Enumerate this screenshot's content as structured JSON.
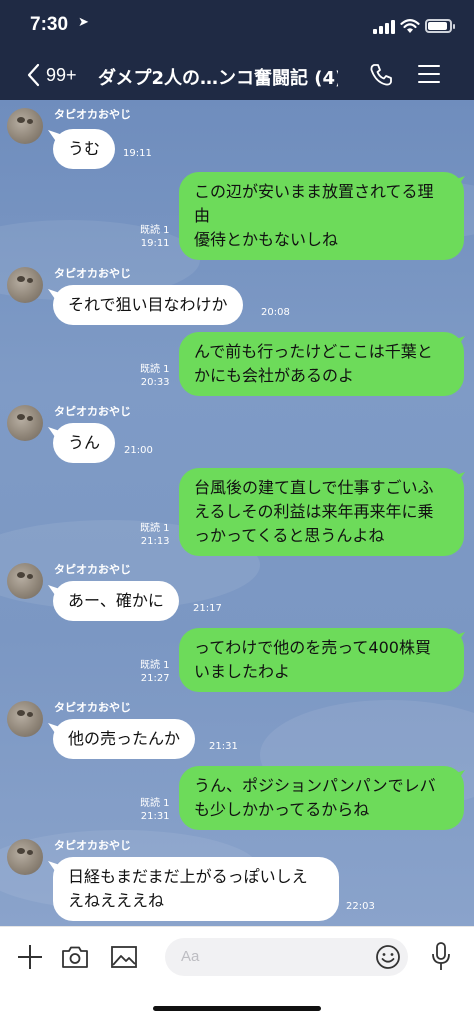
{
  "status_bar": {
    "time": "7:30"
  },
  "header": {
    "back_count": "99+",
    "title": "ダメプ2人の…ンコ奮闘記 (4)"
  },
  "messages": [
    {
      "dir": "in",
      "sender": "タピオカおやじ",
      "lines": [
        "うむ"
      ],
      "time": "19:11"
    },
    {
      "dir": "out",
      "read": "既読 1",
      "lines": [
        "この辺が安いまま放置されてる理",
        "由",
        "優待とかもないしね"
      ],
      "time": "19:11"
    },
    {
      "dir": "in",
      "sender": "タピオカおやじ",
      "lines": [
        "それで狙い目なわけか"
      ],
      "time": "20:08"
    },
    {
      "dir": "out",
      "read": "既読 1",
      "lines": [
        "んで前も行ったけどここは千葉と",
        "かにも会社があるのよ"
      ],
      "time": "20:33"
    },
    {
      "dir": "in",
      "sender": "タピオカおやじ",
      "lines": [
        "うん"
      ],
      "time": "21:00"
    },
    {
      "dir": "out",
      "read": "既読 1",
      "lines": [
        "台風後の建て直しで仕事すごいふ",
        "えるしその利益は来年再来年に乗",
        "っかってくると思うんよね"
      ],
      "time": "21:13"
    },
    {
      "dir": "in",
      "sender": "タピオカおやじ",
      "lines": [
        "あー、確かに"
      ],
      "time": "21:17"
    },
    {
      "dir": "out",
      "read": "既読 1",
      "lines": [
        "ってわけで他のを売って400株買",
        "いましたわよ"
      ],
      "time": "21:27"
    },
    {
      "dir": "in",
      "sender": "タピオカおやじ",
      "lines": [
        "他の売ったんか"
      ],
      "time": "21:31"
    },
    {
      "dir": "out",
      "read": "既読 1",
      "lines": [
        "うん、ポジションパンパンでレバ",
        "も少しかかってるからね"
      ],
      "time": "21:31"
    },
    {
      "dir": "in",
      "sender": "タピオカおやじ",
      "lines": [
        "日経もまだまだ上がるっぽいしえ",
        "えねえええね"
      ],
      "time": "22:03"
    }
  ],
  "composer": {
    "placeholder": "Aa"
  },
  "colors": {
    "bar": "#1f2a44",
    "out_bubble": "#6ddb5a",
    "in_bubble": "#ffffff"
  }
}
